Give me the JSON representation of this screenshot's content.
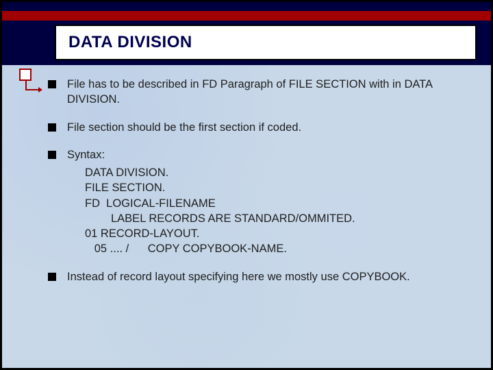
{
  "title": "DATA DIVISION",
  "bullets": {
    "b1": "File has to be described in FD Paragraph of  FILE SECTION with in DATA DIVISION.",
    "b2": "File section should be the first section if coded.",
    "b3_label": "Syntax:",
    "b4": "Instead of record layout specifying  here we mostly use COPYBOOK."
  },
  "syntax": {
    "l1": "DATA DIVISION.",
    "l2": "FILE SECTION.",
    "l3": "FD  LOGICAL-FILENAME",
    "l4": "LABEL RECORDS ARE STANDARD/OMMITED.",
    "l5": "01 RECORD-LAYOUT.",
    "l6": "   05 .... /      COPY COPYBOOK-NAME."
  }
}
